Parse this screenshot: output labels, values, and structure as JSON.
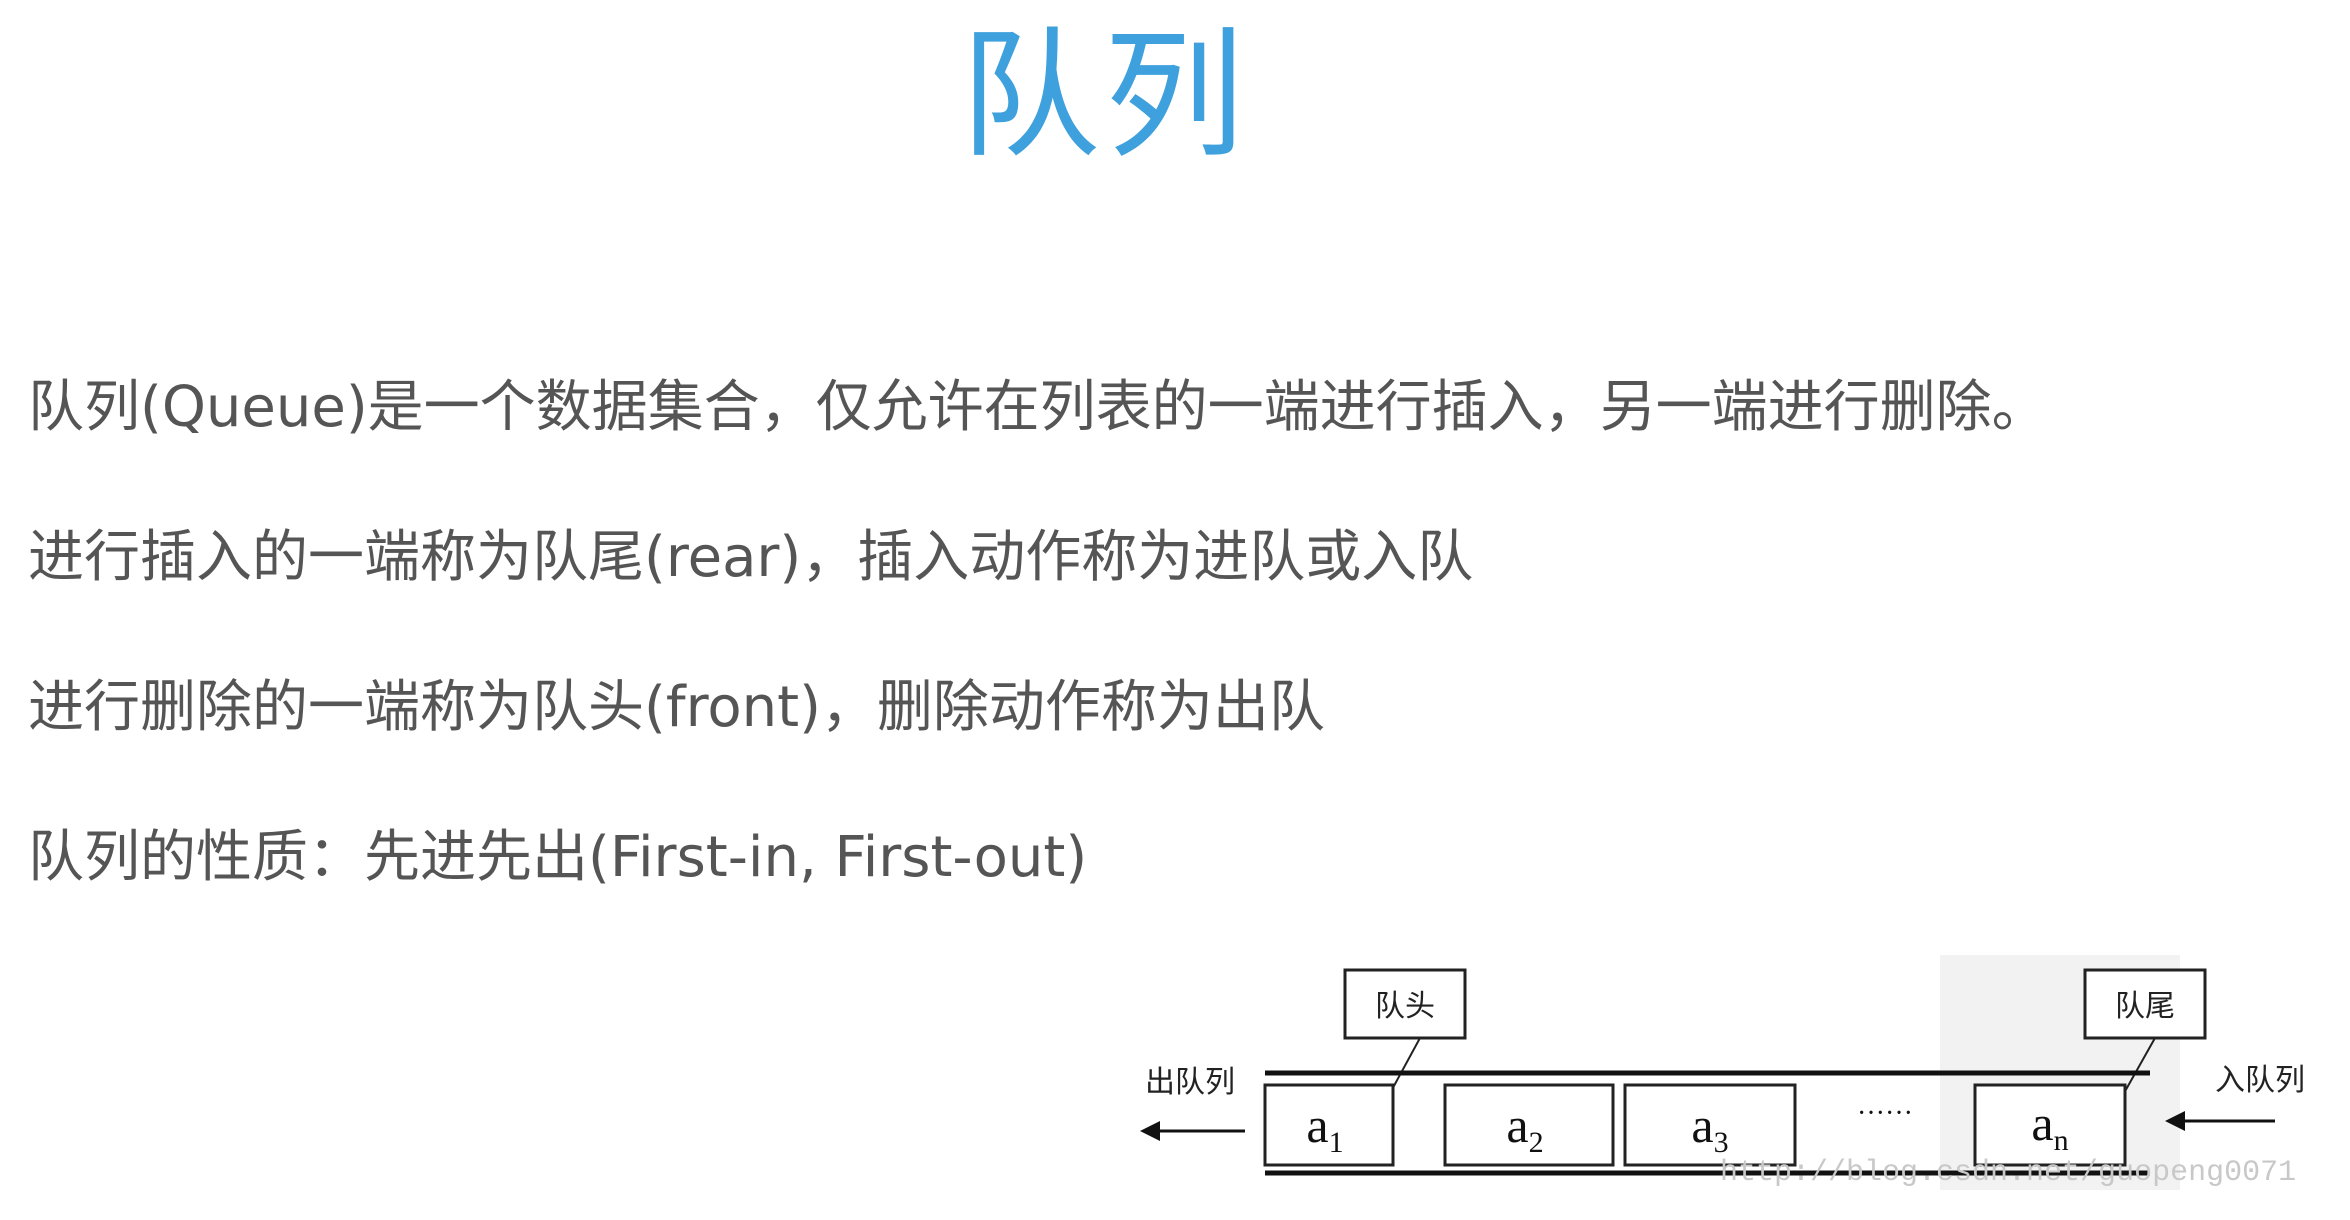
{
  "title": "队列",
  "paragraphs": [
    "队列(Queue)是一个数据集合，仅允许在列表的一端进行插入，另一端进行删除。",
    "进行插入的一端称为队尾(rear)，插入动作称为进队或入队",
    "进行删除的一端称为队头(front)，删除动作称为出队",
    "队列的性质：先进先出(First-in, First-out)"
  ],
  "diagram": {
    "head_label": "队头",
    "tail_label": "队尾",
    "dequeue_label": "出队列",
    "enqueue_label": "入队列",
    "cells": [
      "a",
      "a",
      "a",
      "······",
      "a"
    ],
    "subscripts": [
      "1",
      "2",
      "3",
      "",
      "n"
    ],
    "watermark": "http://blog.csdn.net/guopeng0071"
  },
  "colors": {
    "title": "#3ea0dc",
    "text": "#555555"
  }
}
